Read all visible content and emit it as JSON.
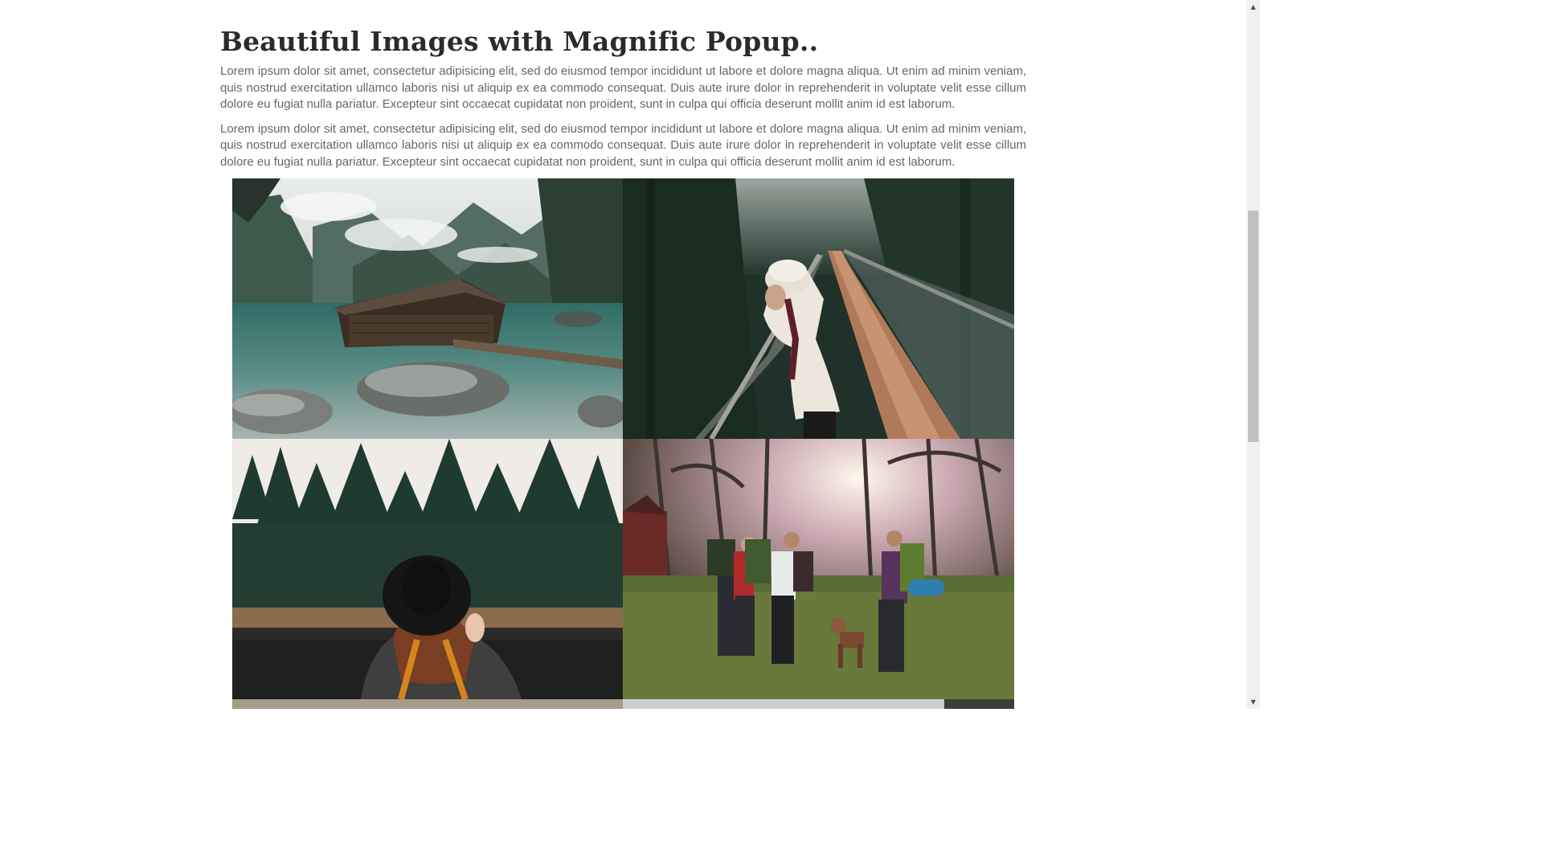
{
  "article": {
    "title": "Beautiful Images with Magnific Popup..",
    "paragraphs": [
      "Lorem ipsum dolor sit amet, consectetur adipisicing elit, sed do eiusmod tempor incididunt ut labore et dolore magna aliqua. Ut enim ad minim veniam, quis nostrud exercitation ullamco laboris nisi ut aliquip ex ea commodo consequat. Duis aute irure dolor in reprehenderit in voluptate velit esse cillum dolore eu fugiat nulla pariatur. Excepteur sint occaecat cupidatat non proident, sunt in culpa qui officia deserunt mollit anim id est laborum.",
      "Lorem ipsum dolor sit amet, consectetur adipisicing elit, sed do eiusmod tempor incididunt ut labore et dolore magna aliqua. Ut enim ad minim veniam, quis nostrud exercitation ullamco laboris nisi ut aliquip ex ea commodo consequat. Duis aute irure dolor in reprehenderit in voluptate velit esse cillum dolore eu fugiat nulla pariatur. Excepteur sint occaecat cupidatat non proident, sunt in culpa qui officia deserunt mollit anim id est laborum."
    ]
  },
  "gallery": {
    "images": [
      {
        "subject": "lake-boathouse-mountains"
      },
      {
        "subject": "woman-on-suspension-bridge"
      },
      {
        "subject": "woman-in-hat-by-forest-lake"
      },
      {
        "subject": "hikers-with-dog-in-woods"
      },
      {
        "subject": "partially-visible-photo"
      },
      {
        "subject": "partially-visible-photo"
      }
    ]
  },
  "scrollbar": {
    "up_arrow_icon": "triangle-up",
    "down_arrow_icon": "triangle-down",
    "position": 0.3
  },
  "colors": {
    "title": "#2b2b2b",
    "body_text": "#666666",
    "background": "#ffffff"
  }
}
